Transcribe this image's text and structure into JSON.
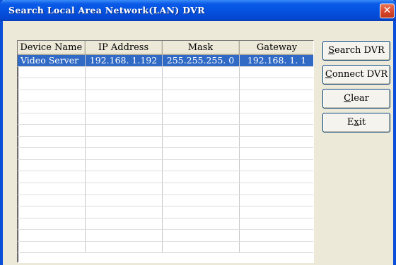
{
  "window": {
    "title": "Search Local Area Network(LAN) DVR",
    "close_glyph": "✕"
  },
  "table": {
    "columns": [
      "Device Name",
      "IP Address",
      "Mask",
      "Gateway"
    ],
    "rows": [
      [
        "Video Server",
        "192.168.  1.192",
        "255.255.255.  0",
        "192.168.  1.  1"
      ]
    ],
    "selected_row": 0,
    "total_visible_rows": 17
  },
  "buttons": {
    "search": "Search DVR",
    "connect": "Connect DVR",
    "clear": "Clear",
    "exit": "Exit"
  },
  "colors": {
    "titlebar": "#0553e0",
    "selection": "#316ac5",
    "dialog_bg": "#ece9d8"
  }
}
